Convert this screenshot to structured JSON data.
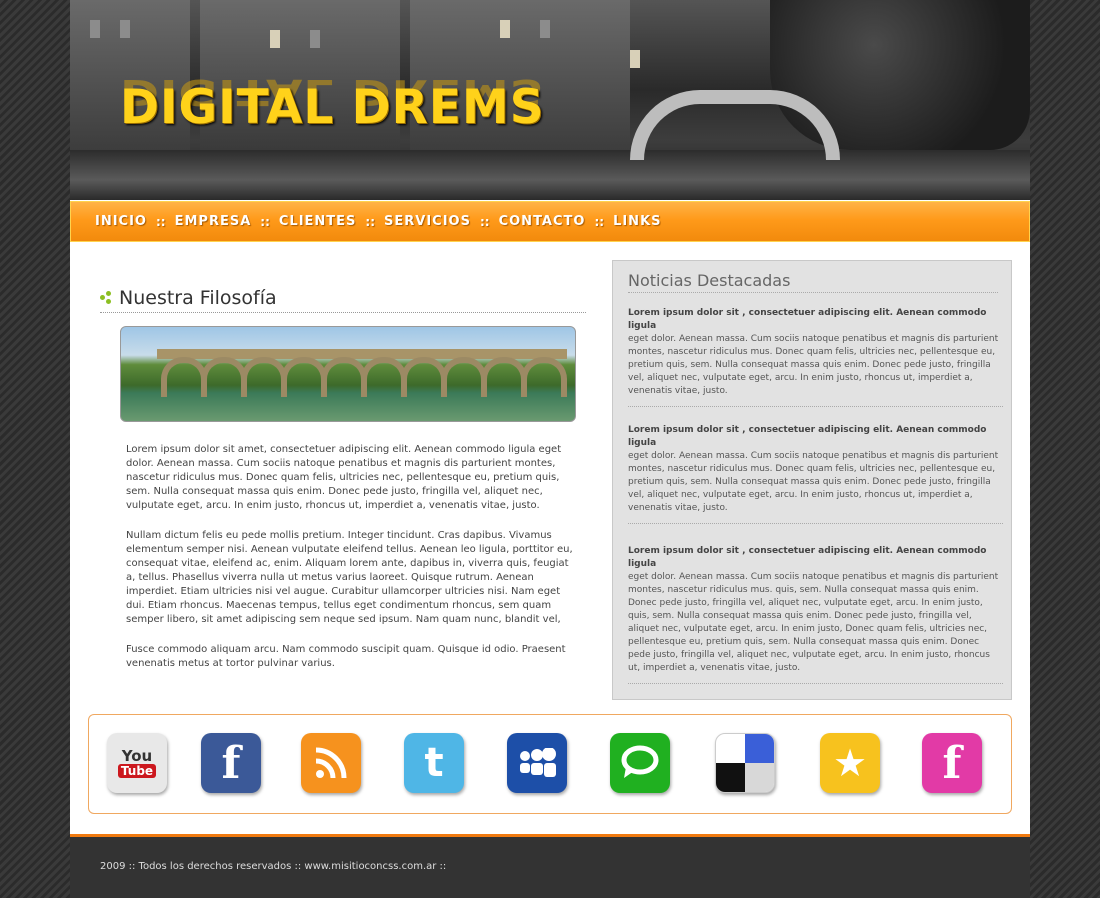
{
  "brand": {
    "logo_text": "DIGITAL DREMS"
  },
  "nav": {
    "items": [
      "INICIO",
      "EMPRESA",
      "CLIENTES",
      "SERVICIOS",
      "CONTACTO",
      "LINKS"
    ],
    "separator": "::"
  },
  "philosophy": {
    "title": "Nuestra Filosofía",
    "paragraphs": [
      "Lorem ipsum dolor sit amet, consectetuer adipiscing elit. Aenean commodo ligula eget dolor. Aenean massa. Cum sociis natoque penatibus et magnis dis parturient montes, nascetur ridiculus mus. Donec quam felis, ultricies nec, pellentesque eu, pretium quis, sem. Nulla consequat massa quis enim. Donec pede justo, fringilla vel, aliquet nec, vulputate eget, arcu. In enim justo, rhoncus ut, imperdiet a, venenatis vitae, justo.",
      "Nullam dictum felis eu pede mollis pretium. Integer tincidunt. Cras dapibus. Vivamus elementum semper nisi. Aenean vulputate eleifend tellus. Aenean leo ligula, porttitor eu, consequat vitae, eleifend ac, enim. Aliquam lorem ante, dapibus in, viverra quis, feugiat a, tellus. Phasellus viverra nulla ut metus varius laoreet. Quisque rutrum. Aenean imperdiet. Etiam ultricies nisi vel augue. Curabitur ullamcorper ultricies nisi. Nam eget dui. Etiam rhoncus. Maecenas tempus, tellus eget condimentum rhoncus, sem quam semper libero, sit amet adipiscing sem neque sed ipsum. Nam quam nunc, blandit vel,",
      " Fusce commodo aliquam arcu. Nam commodo suscipit quam. Quisque id odio. Praesent venenatis metus at tortor pulvinar varius."
    ]
  },
  "news": {
    "title": "Noticias Destacadas",
    "items": [
      {
        "lead": "Lorem ipsum dolor sit , consectetuer adipiscing elit. Aenean commodo ligula",
        "body": "eget dolor. Aenean massa. Cum sociis natoque penatibus et magnis dis parturient montes, nascetur ridiculus mus. Donec quam felis, ultricies nec, pellentesque eu, pretium quis, sem. Nulla consequat massa quis enim. Donec pede justo, fringilla vel, aliquet nec, vulputate eget, arcu. In enim justo, rhoncus ut, imperdiet a, venenatis vitae, justo."
      },
      {
        "lead": "Lorem ipsum dolor sit , consectetuer adipiscing elit. Aenean commodo ligula",
        "body": "eget dolor. Aenean massa. Cum sociis natoque penatibus et magnis dis parturient montes, nascetur ridiculus mus. Donec quam felis, ultricies nec, pellentesque eu, pretium quis, sem. Nulla consequat massa quis enim. Donec pede justo, fringilla vel, aliquet nec, vulputate eget, arcu. In enim justo, rhoncus ut, imperdiet a, venenatis vitae, justo."
      },
      {
        "lead": "Lorem ipsum dolor sit , consectetuer adipiscing elit. Aenean commodo ligula",
        "body": "eget dolor. Aenean massa. Cum sociis natoque penatibus et magnis dis parturient montes, nascetur ridiculus mus. quis, sem. Nulla consequat massa quis enim. Donec pede justo, fringilla vel, aliquet nec, vulputate eget, arcu. In enim justo, quis, sem. Nulla consequat massa quis enim. Donec pede justo, fringilla vel, aliquet nec, vulputate eget, arcu. In enim justo, Donec quam felis, ultricies nec, pellentesque eu, pretium quis, sem. Nulla consequat massa quis enim. Donec pede justo, fringilla vel, aliquet nec, vulputate eget, arcu. In enim justo, rhoncus ut, imperdiet a, venenatis vitae, justo."
      }
    ]
  },
  "social": {
    "icons": [
      {
        "name": "youtube-icon",
        "glyph_top": "You",
        "glyph_bottom": "Tube",
        "color": "#e8e8e8",
        "accent": "#cc181e"
      },
      {
        "name": "facebook-icon",
        "glyph": "f",
        "color": "#3b5998"
      },
      {
        "name": "rss-icon",
        "glyph": "◥",
        "color": "#f6921e"
      },
      {
        "name": "twitter-icon",
        "glyph": "t",
        "color": "#4fb6e6"
      },
      {
        "name": "myspace-icon",
        "glyph": "●●●",
        "color": "#1d4fa8"
      },
      {
        "name": "technorati-icon",
        "glyph": "◉",
        "color": "#20b020"
      },
      {
        "name": "delicious-icon",
        "glyph": "",
        "color": "#ffffff"
      },
      {
        "name": "favorites-star-icon",
        "glyph": "★",
        "color": "#f7c21e"
      },
      {
        "name": "facebook-pink-icon",
        "glyph": "f",
        "color": "#e23aa6"
      }
    ]
  },
  "footer": {
    "text": "2009 :: Todos los derechos reservados :: www.misitioconcss.com.ar ::"
  }
}
